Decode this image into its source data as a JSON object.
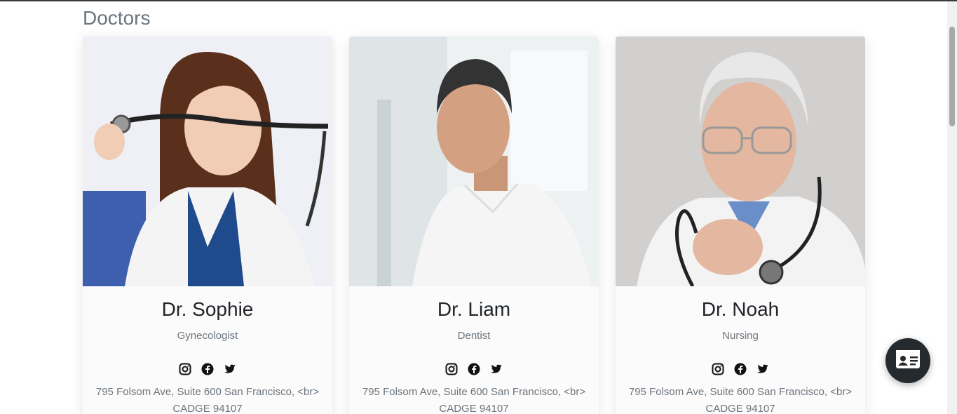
{
  "page": {
    "title": "Doctors"
  },
  "doctors": [
    {
      "name": "Dr. Sophie",
      "specialty": "Gynecologist",
      "address_line1": "795 Folsom Ave, Suite 600 San Francisco, <br>",
      "address_line2": "CADGE 94107"
    },
    {
      "name": "Dr. Liam",
      "specialty": "Dentist",
      "address_line1": "795 Folsom Ave, Suite 600 San Francisco, <br>",
      "address_line2": "CADGE 94107"
    },
    {
      "name": "Dr. Noah",
      "specialty": "Nursing",
      "address_line1": "795 Folsom Ave, Suite 600 San Francisco, <br>",
      "address_line2": "CADGE 94107"
    }
  ],
  "icons": {
    "social": [
      "instagram-icon",
      "facebook-icon",
      "twitter-icon"
    ],
    "fab": "contact-card-icon"
  },
  "colors": {
    "fab_bg": "#252a2e",
    "muted_text": "#6c757d",
    "heading_text": "#212529"
  }
}
